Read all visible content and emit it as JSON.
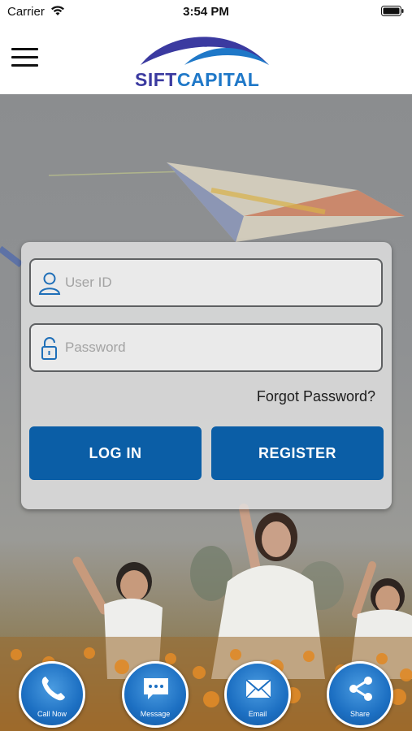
{
  "status_bar": {
    "carrier": "Carrier",
    "time": "3:54 PM",
    "icons": [
      "wifi-icon",
      "battery-icon"
    ]
  },
  "header": {
    "menu_icon": "hamburger-menu-icon",
    "logo": {
      "part1": "SIFT",
      "part2": "CAPITAL"
    }
  },
  "login": {
    "user_id_placeholder": "User ID",
    "user_id_value": "",
    "password_placeholder": "Password",
    "password_value": "",
    "forgot_password": "Forgot Password?",
    "login_button": "LOG IN",
    "register_button": "REGISTER"
  },
  "actions": [
    {
      "label": "Call Now",
      "icon": "phone-icon"
    },
    {
      "label": "Message",
      "icon": "message-icon"
    },
    {
      "label": "Email",
      "icon": "envelope-icon"
    },
    {
      "label": "Share",
      "icon": "share-icon"
    }
  ],
  "colors": {
    "primary_button": "#0b5ea6",
    "logo_dark": "#3b3aa0",
    "logo_light": "#1f78c8",
    "action_button": "#1c6fc2"
  }
}
